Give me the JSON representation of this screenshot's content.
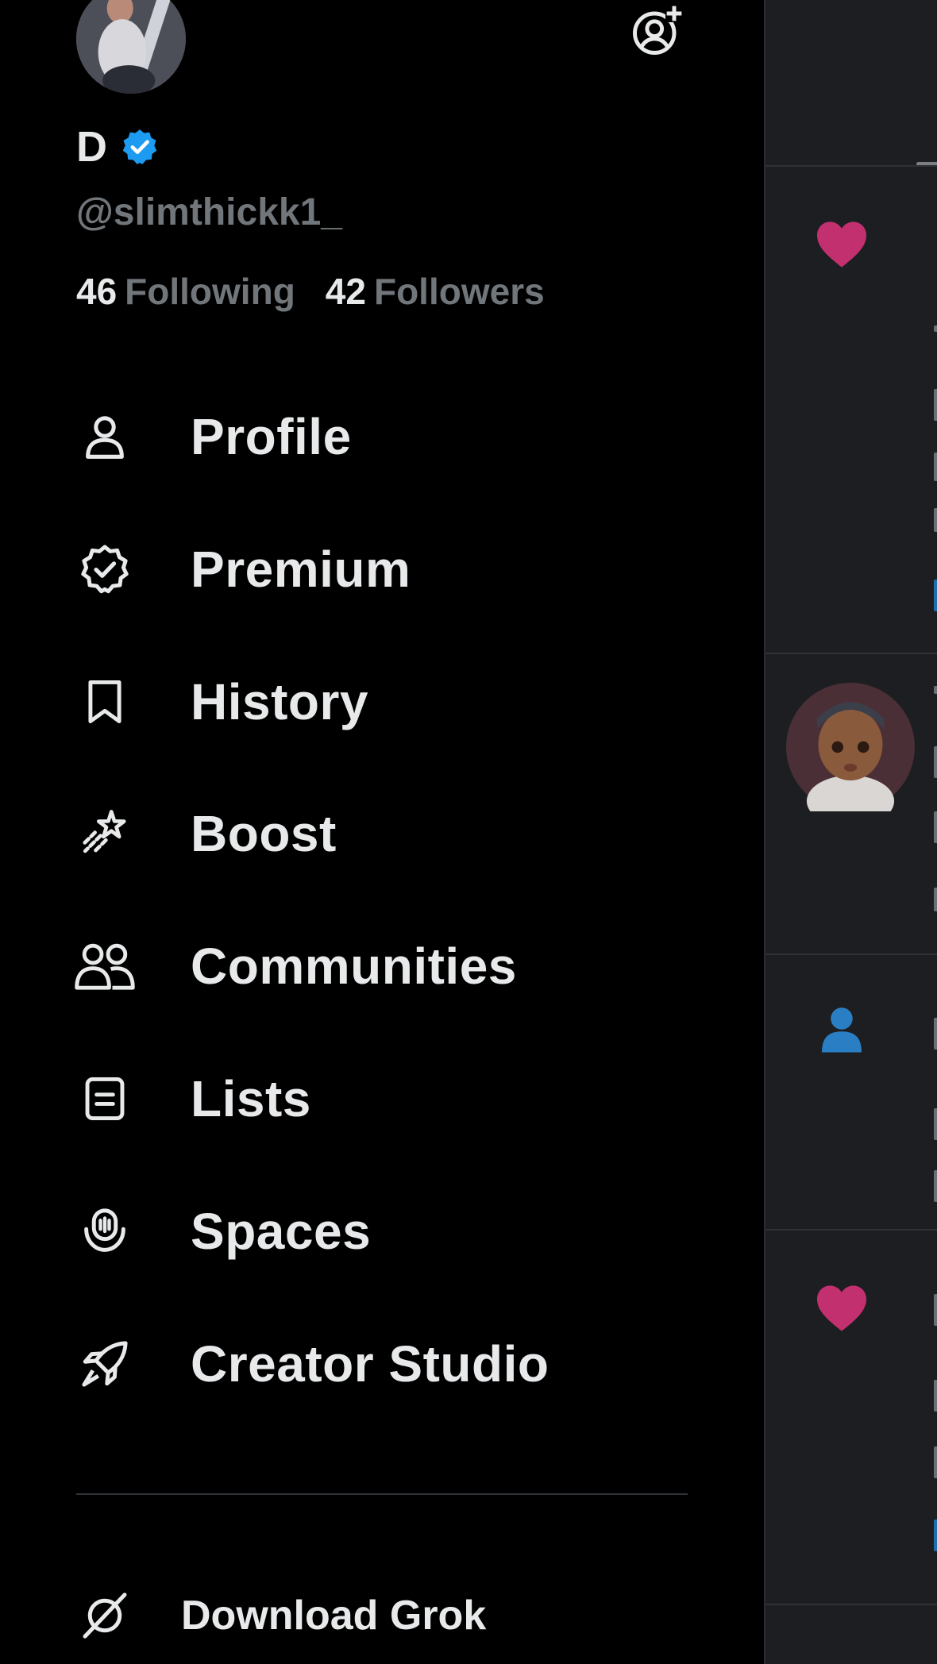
{
  "profile": {
    "display_name": "D",
    "handle": "@slimthickk1_",
    "following_count": "46",
    "following_label": "Following",
    "followers_count": "42",
    "followers_label": "Followers",
    "verified": true
  },
  "menu": {
    "items": [
      {
        "label": "Profile",
        "icon": "person-icon"
      },
      {
        "label": "Premium",
        "icon": "verified-badge-icon"
      },
      {
        "label": "History",
        "icon": "bookmark-icon"
      },
      {
        "label": "Boost",
        "icon": "sparkle-icon"
      },
      {
        "label": "Communities",
        "icon": "people-icon"
      },
      {
        "label": "Lists",
        "icon": "list-icon"
      },
      {
        "label": "Spaces",
        "icon": "microphone-icon"
      },
      {
        "label": "Creator Studio",
        "icon": "rocket-icon"
      }
    ],
    "grok_label": "Download Grok"
  },
  "colors": {
    "background": "#000000",
    "text": "#e7e9ea",
    "muted": "#71767b",
    "verified_blue": "#1d9bf0",
    "like_pink": "#f91880",
    "backdrop": "#1d1e21"
  }
}
